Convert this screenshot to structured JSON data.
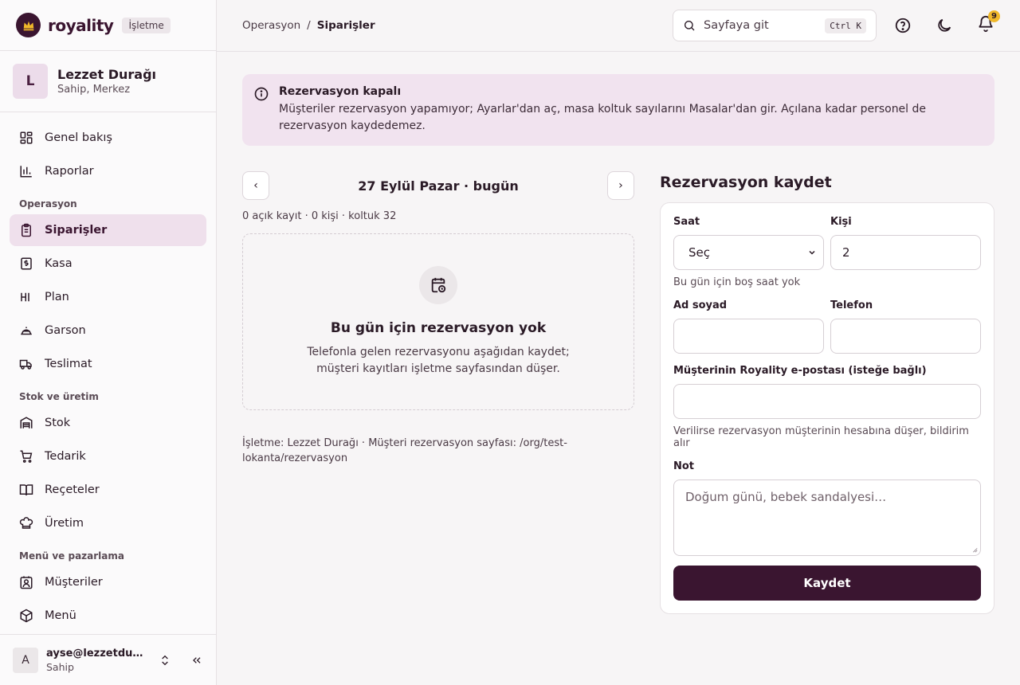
{
  "brand": {
    "name": "royality",
    "badge": "İşletme"
  },
  "org": {
    "initial": "L",
    "name": "Lezzet Durağı",
    "role": "Sahip, Merkez"
  },
  "nav": {
    "top": [
      {
        "label": "Genel bakış",
        "icon": "dashboard-icon"
      },
      {
        "label": "Raporlar",
        "icon": "bar-chart-icon"
      }
    ],
    "sections": [
      {
        "title": "Operasyon",
        "items": [
          {
            "label": "Siparişler",
            "icon": "clipboard-icon",
            "active": true
          },
          {
            "label": "Kasa",
            "icon": "cash-icon"
          },
          {
            "label": "Plan",
            "icon": "grid-icon"
          },
          {
            "label": "Garson",
            "icon": "cloche-icon"
          },
          {
            "label": "Teslimat",
            "icon": "truck-icon"
          }
        ]
      },
      {
        "title": "Stok ve üretim",
        "items": [
          {
            "label": "Stok",
            "icon": "warehouse-icon"
          },
          {
            "label": "Tedarik",
            "icon": "cart-icon"
          },
          {
            "label": "Reçeteler",
            "icon": "book-icon"
          },
          {
            "label": "Üretim",
            "icon": "chef-hat-icon"
          }
        ]
      },
      {
        "title": "Menü ve pazarlama",
        "items": [
          {
            "label": "Müşteriler",
            "icon": "contact-icon"
          },
          {
            "label": "Menü",
            "icon": "package-icon"
          }
        ]
      }
    ]
  },
  "user": {
    "initial": "A",
    "email": "ayse@lezzetdurağı",
    "role": "Sahip"
  },
  "topbar": {
    "breadcrumb": {
      "parent": "Operasyon",
      "separator": "/",
      "current": "Siparişler"
    },
    "search": {
      "placeholder": "Sayfaya git",
      "shortcut": "Ctrl K"
    },
    "notifications": "9"
  },
  "alert": {
    "title": "Rezervasyon kapalı",
    "text": "Müşteriler rezervasyon yapamıyor; Ayarlar'dan aç, masa koltuk sayılarını Masalar'dan gir. Açılana kadar personel de rezervasyon kaydedemez."
  },
  "calendar": {
    "prev": "‹",
    "next": "›",
    "date_label": "27 Eylül Pazar · bugün",
    "stats": "0 açık kayıt · 0 kişi · koltuk 32",
    "empty_title": "Bu gün için rezervasyon yok",
    "empty_text": "Telefonla gelen rezervasyonu aşağıdan kaydet; müşteri kayıtları işletme sayfasından düşer.",
    "footnote": "İşletme: Lezzet Durağı · Müşteri rezervasyon sayfası: /org/test-lokanta/rezervasyon"
  },
  "form": {
    "title": "Rezervasyon kaydet",
    "time_label": "Saat",
    "time_value": "Seç",
    "time_hint": "Bu gün için boş saat yok",
    "people_label": "Kişi",
    "people_value": "2",
    "name_label": "Ad soyad",
    "name_value": "",
    "phone_label": "Telefon",
    "phone_value": "",
    "email_label": "Müşterinin Royality e-postası (isteğe bağlı)",
    "email_value": "",
    "email_hint": "Verilirse rezervasyon müşterinin hesabına düşer, bildirim alır",
    "note_label": "Not",
    "note_placeholder": "Doğum günü, bebek sandalyesi…",
    "submit": "Kaydet"
  }
}
